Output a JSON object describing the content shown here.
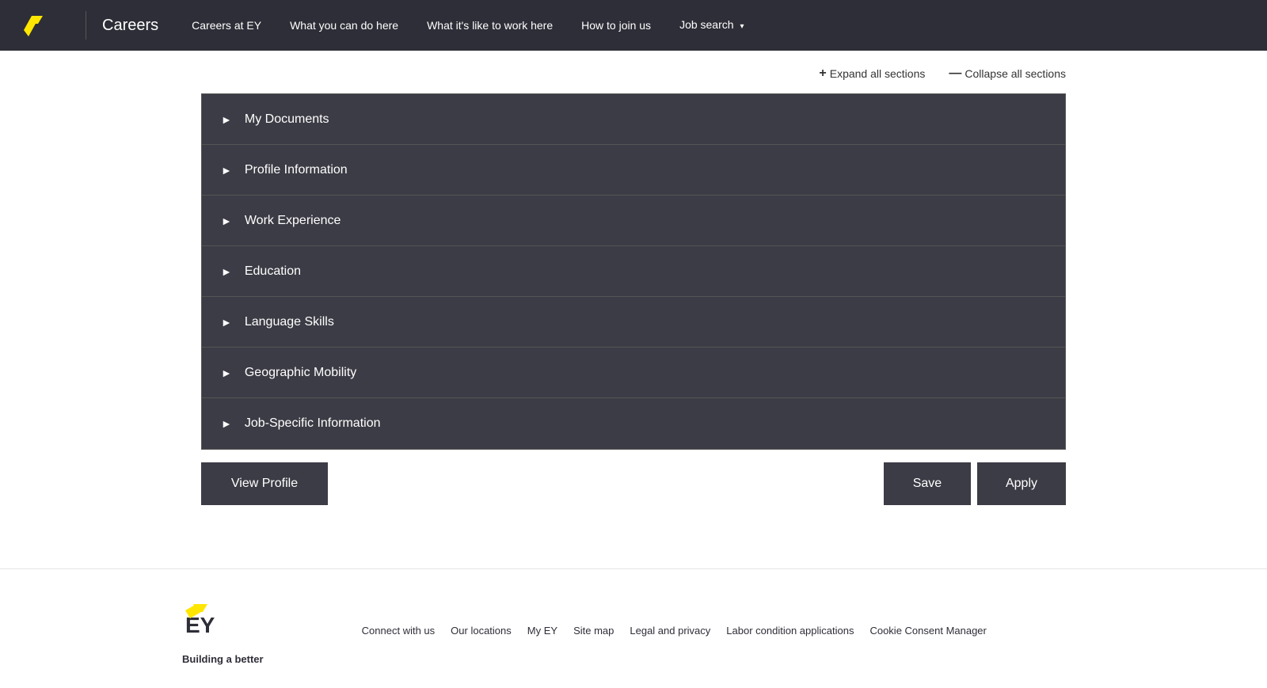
{
  "nav": {
    "brand": "Careers",
    "links": [
      {
        "id": "careers-at-ey",
        "label": "Careers at EY",
        "active": false
      },
      {
        "id": "what-you-can-do",
        "label": "What you can do here",
        "active": false
      },
      {
        "id": "what-its-like",
        "label": "What it's like to work here",
        "active": false
      },
      {
        "id": "how-to-join",
        "label": "How to join us",
        "active": false
      },
      {
        "id": "job-search",
        "label": "Job search",
        "active": false,
        "hasDropdown": true
      }
    ]
  },
  "controls": {
    "expand_label": "Expand all sections",
    "collapse_label": "Collapse all sections"
  },
  "accordion": {
    "sections": [
      {
        "id": "my-documents",
        "label": "My Documents"
      },
      {
        "id": "profile-information",
        "label": "Profile Information"
      },
      {
        "id": "work-experience",
        "label": "Work Experience"
      },
      {
        "id": "education",
        "label": "Education"
      },
      {
        "id": "language-skills",
        "label": "Language Skills"
      },
      {
        "id": "geographic-mobility",
        "label": "Geographic Mobility"
      },
      {
        "id": "job-specific-information",
        "label": "Job-Specific Information"
      }
    ]
  },
  "buttons": {
    "view_profile": "View Profile",
    "save": "Save",
    "apply": "Apply"
  },
  "footer": {
    "logo_text": "Building a better",
    "links": [
      {
        "id": "connect-with-us",
        "label": "Connect with us"
      },
      {
        "id": "our-locations",
        "label": "Our locations"
      },
      {
        "id": "my-ey",
        "label": "My EY"
      },
      {
        "id": "site-map",
        "label": "Site map"
      },
      {
        "id": "legal-and-privacy",
        "label": "Legal and privacy"
      },
      {
        "id": "labor-condition",
        "label": "Labor condition applications"
      },
      {
        "id": "cookie-consent",
        "label": "Cookie Consent Manager"
      }
    ]
  }
}
